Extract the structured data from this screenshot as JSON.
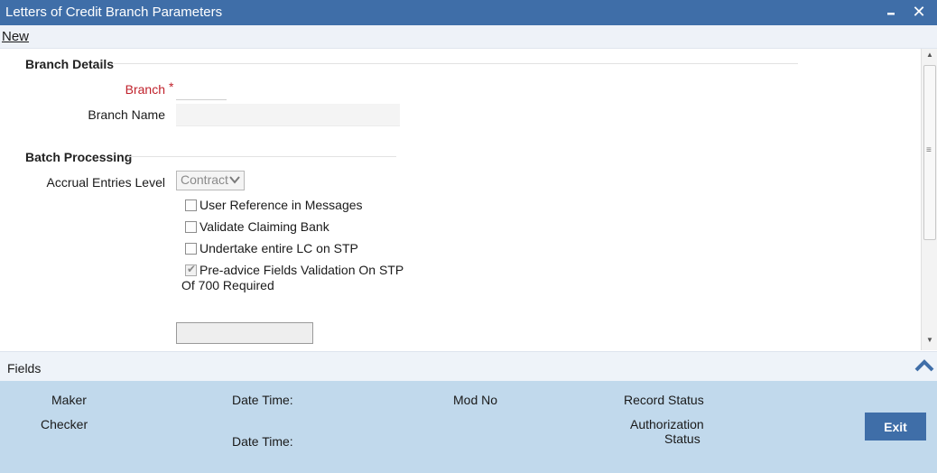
{
  "window": {
    "title": "Letters of Credit Branch Parameters",
    "minimize_glyph": "▬",
    "close_glyph": "✕"
  },
  "toolbar": {
    "new_label": "New"
  },
  "branch_details": {
    "title": "Branch Details",
    "branch_label": "Branch",
    "required_marker": "*",
    "branch_value": "",
    "branch_name_label": "Branch Name",
    "branch_name_value": ""
  },
  "batch_processing": {
    "title": "Batch Processing",
    "accrual_label": "Accrual Entries Level",
    "accrual_value": "Contract",
    "checkboxes": [
      {
        "label": "User Reference in Messages",
        "checked": false
      },
      {
        "label": "Validate Claiming Bank",
        "checked": false
      },
      {
        "label": "Undertake entire LC on STP",
        "checked": false
      },
      {
        "label": "Pre-advice Fields Validation On STP",
        "checked": true,
        "enabled": false
      }
    ],
    "checkbox_continuation": "Of 700 Required"
  },
  "fields_bar": {
    "label": "Fields",
    "icon": "chevron-up-icon"
  },
  "audit": {
    "maker_label": "Maker",
    "checker_label": "Checker",
    "date_time_label_1": "Date Time:",
    "date_time_label_2": "Date Time:",
    "mod_no_label": "Mod No",
    "record_status_label": "Record Status",
    "authorization_label_line1": "Authorization",
    "authorization_label_line2": "Status",
    "exit_label": "Exit"
  },
  "colors": {
    "title_bar": "#3f6ea8",
    "audit_panel": "#c1d9ec",
    "required_label": "#c0212b",
    "exit_button": "#3f6ea8"
  }
}
